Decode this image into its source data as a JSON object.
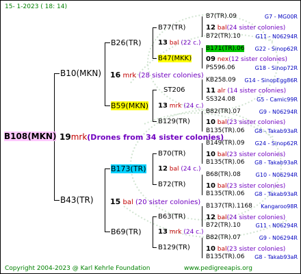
{
  "header": {
    "date": "15-  1-2023 ( 18: 14)"
  },
  "root": {
    "label": "B108(MKN)",
    "color": "#ffc8ff"
  },
  "root_note": {
    "num": "19",
    "sp": "mrk",
    "text": "(Drones from 34 sister colonies)"
  },
  "gen1": [
    {
      "label": "B10(MKN)",
      "num": "16",
      "sp": "mrk",
      "colonies": "(28 sister colonies)"
    },
    {
      "label": "B43(TR)",
      "num": "15",
      "sp": "bal",
      "colonies": "(20 sister colonies)"
    }
  ],
  "gen2": [
    {
      "label": "B26(TR)",
      "num": "13",
      "sp": "bal",
      "colonies": "(22 c.)"
    },
    {
      "label": "B59(MKN)",
      "num": "13",
      "sp": "mrk",
      "colonies": "(24 c.)",
      "color": "#ffff00"
    },
    {
      "label": "B173(TR)",
      "num": "12",
      "sp": "bal",
      "colonies": "(24 c.)",
      "color": "#00d0ff"
    },
    {
      "label": "B69(TR)",
      "num": "13",
      "sp": "mrk",
      "colonies": "(24 c.)"
    }
  ],
  "gen3": [
    {
      "label": "B77(TR)",
      "num": "12",
      "sp": "bal",
      "colonies": "(24 sister colonies)"
    },
    {
      "label": "B47(MKK)",
      "num": "09",
      "sp": "nex",
      "colonies": "(12 sister colonies)",
      "color": "#ffff00"
    },
    {
      "label": "ST206",
      "num": "11",
      "sp": "alr",
      "colonies": "(14 sister colonies)"
    },
    {
      "label": "B129(TR)",
      "num": "10",
      "sp": "bal",
      "colonies": "(23 sister colonies)"
    },
    {
      "label": "B70(TR)",
      "num": "10",
      "sp": "bal",
      "colonies": "(23 sister colonies)"
    },
    {
      "label": "B72(TR)",
      "num": "10",
      "sp": "bal",
      "colonies": "(23 sister colonies)"
    },
    {
      "label": "B63(TR)",
      "num": "12",
      "sp": "bal",
      "colonies": "(24 sister colonies)"
    },
    {
      "label": "B129(TR)",
      "num": "10",
      "sp": "bal",
      "colonies": "(23 sister colonies)"
    }
  ],
  "gen4": [
    {
      "left": "B7(TR).09",
      "right": "G7 - MG00R"
    },
    {
      "left": "B72(TR).10",
      "right": "G11 - N06294R"
    },
    {
      "left": "B171(TR).06",
      "right": "G22 - Sinop62R",
      "color": "#00c800"
    },
    {
      "left": "PS596.06",
      "right": "G18 - Sinop72R"
    },
    {
      "left": "KB258.09",
      "right": "G14 - SinopEgg86R"
    },
    {
      "left": "SS324.08",
      "right": "G5 - Camic99R"
    },
    {
      "left": "B82(TR).07",
      "right": "G9 - N06294R"
    },
    {
      "left": "B135(TR).06",
      "right": "G8 - Takab93aR"
    },
    {
      "left": "B149(TR).09",
      "right": "G24 - Sinop62R"
    },
    {
      "left": "B135(TR).06",
      "right": "G8 - Takab93aR"
    },
    {
      "left": "B68(TR).08",
      "right": "G10 - N06294R"
    },
    {
      "left": "B135(TR).06",
      "right": "G8 - Takab93aR"
    },
    {
      "left": "B137(TR).1168",
      "right": "Kangaroo98R"
    },
    {
      "left": "B72(TR).10",
      "right": "G11 - N06294R"
    },
    {
      "left": "B82(TR).07",
      "right": "G9 - N06294R"
    },
    {
      "left": "B135(TR).06",
      "right": "G8 - Takab93aR"
    }
  ],
  "footer": {
    "copyright": "Copyright 2004-2023 @ Karl Kehrle Foundation",
    "url": "www.pedigreeapis.org"
  }
}
